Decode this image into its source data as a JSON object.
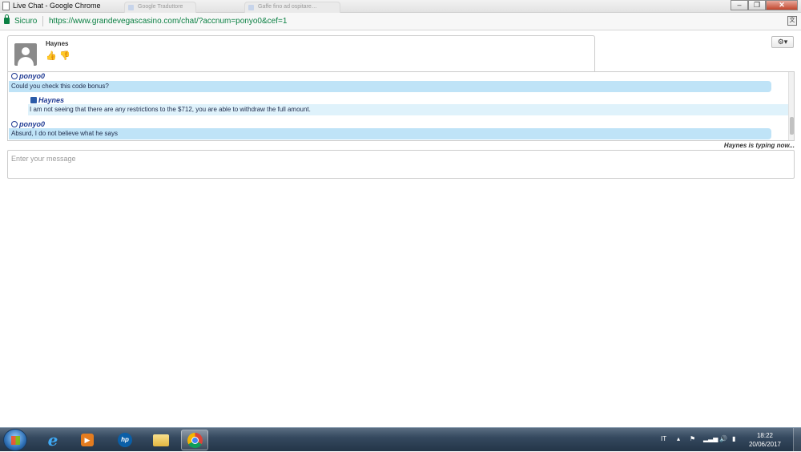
{
  "window": {
    "title": "Live Chat - Google Chrome",
    "ghost_tabs": [
      "Google Traduttore",
      "Gaffe fino ad ospitare…"
    ]
  },
  "address_bar": {
    "security_label": "Sicuro",
    "url": "https://www.grandevegascasino.com/chat/?accnum=ponyo0&cef=1"
  },
  "chat": {
    "agent_name": "Haynes",
    "messages": [
      {
        "sender": "ponyo0",
        "role": "visitor",
        "text": "Could you check this code bonus?"
      },
      {
        "sender": "Haynes",
        "role": "agent",
        "text": "I am not seeing that there are any restrictions to the $712, you are able to withdraw the full amount."
      },
      {
        "sender": "ponyo0",
        "role": "visitor",
        "text": "Absurd, I do not believe what he says"
      }
    ],
    "typing_indicator": "Haynes is typing now...",
    "input_placeholder": "Enter your message"
  },
  "taskbar": {
    "language": "IT",
    "time": "18:22",
    "date": "20/06/2017"
  },
  "colors": {
    "secure_green": "#0b8043",
    "visitor_bubble": "#bfe3f7",
    "agent_bubble": "#dff2fb",
    "sender_blue": "#1f3a93"
  }
}
